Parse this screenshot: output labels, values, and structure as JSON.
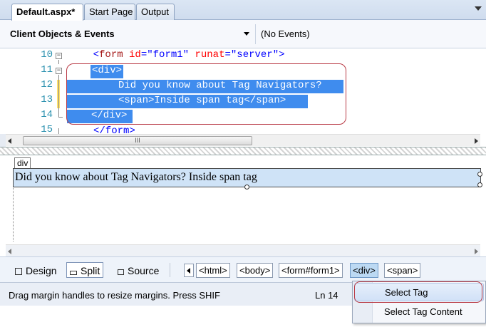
{
  "tabs": [
    {
      "label": "Default.aspx*",
      "active": true
    },
    {
      "label": "Start Page",
      "active": false
    },
    {
      "label": "Output",
      "active": false
    }
  ],
  "dropdowns": {
    "objects": "Client Objects & Events",
    "events": "(No Events)"
  },
  "editor": {
    "line_numbers": [
      "10",
      "11",
      "12",
      "13",
      "14",
      "15"
    ],
    "line10": {
      "indent": "    ",
      "open": "<",
      "tagname": "form",
      "sp1": " ",
      "attr1": "id",
      "eq1": "=",
      "val1": "\"form1\"",
      "sp2": " ",
      "attr2": "runat",
      "eq2": "=",
      "val2": "\"server\"",
      "close": ">"
    },
    "line11": "<div>",
    "line12": "Did you know about Tag Navigators?",
    "line13": "<span>Inside span tag</span>",
    "line14": "</div>",
    "line15": "</form>"
  },
  "scroll_thumb_glyph": "III",
  "design": {
    "tag_label": "div",
    "content": "Did you know about Tag Navigators? Inside span tag"
  },
  "viewbar": {
    "design": "Design",
    "split": "Split",
    "source": "Source"
  },
  "breadcrumbs": [
    "<html>",
    "<body>",
    "<form#form1>",
    "<div>",
    "<span>"
  ],
  "status": {
    "message": "Drag margin handles to resize margins. Press SHIF",
    "line": "Ln 14"
  },
  "context_menu": {
    "items": [
      "Select Tag",
      "Select Tag Content"
    ]
  },
  "colors": {
    "selection": "#3f8cee",
    "highlight_border": "#b93b46",
    "design_fill": "#cfe3f7"
  }
}
